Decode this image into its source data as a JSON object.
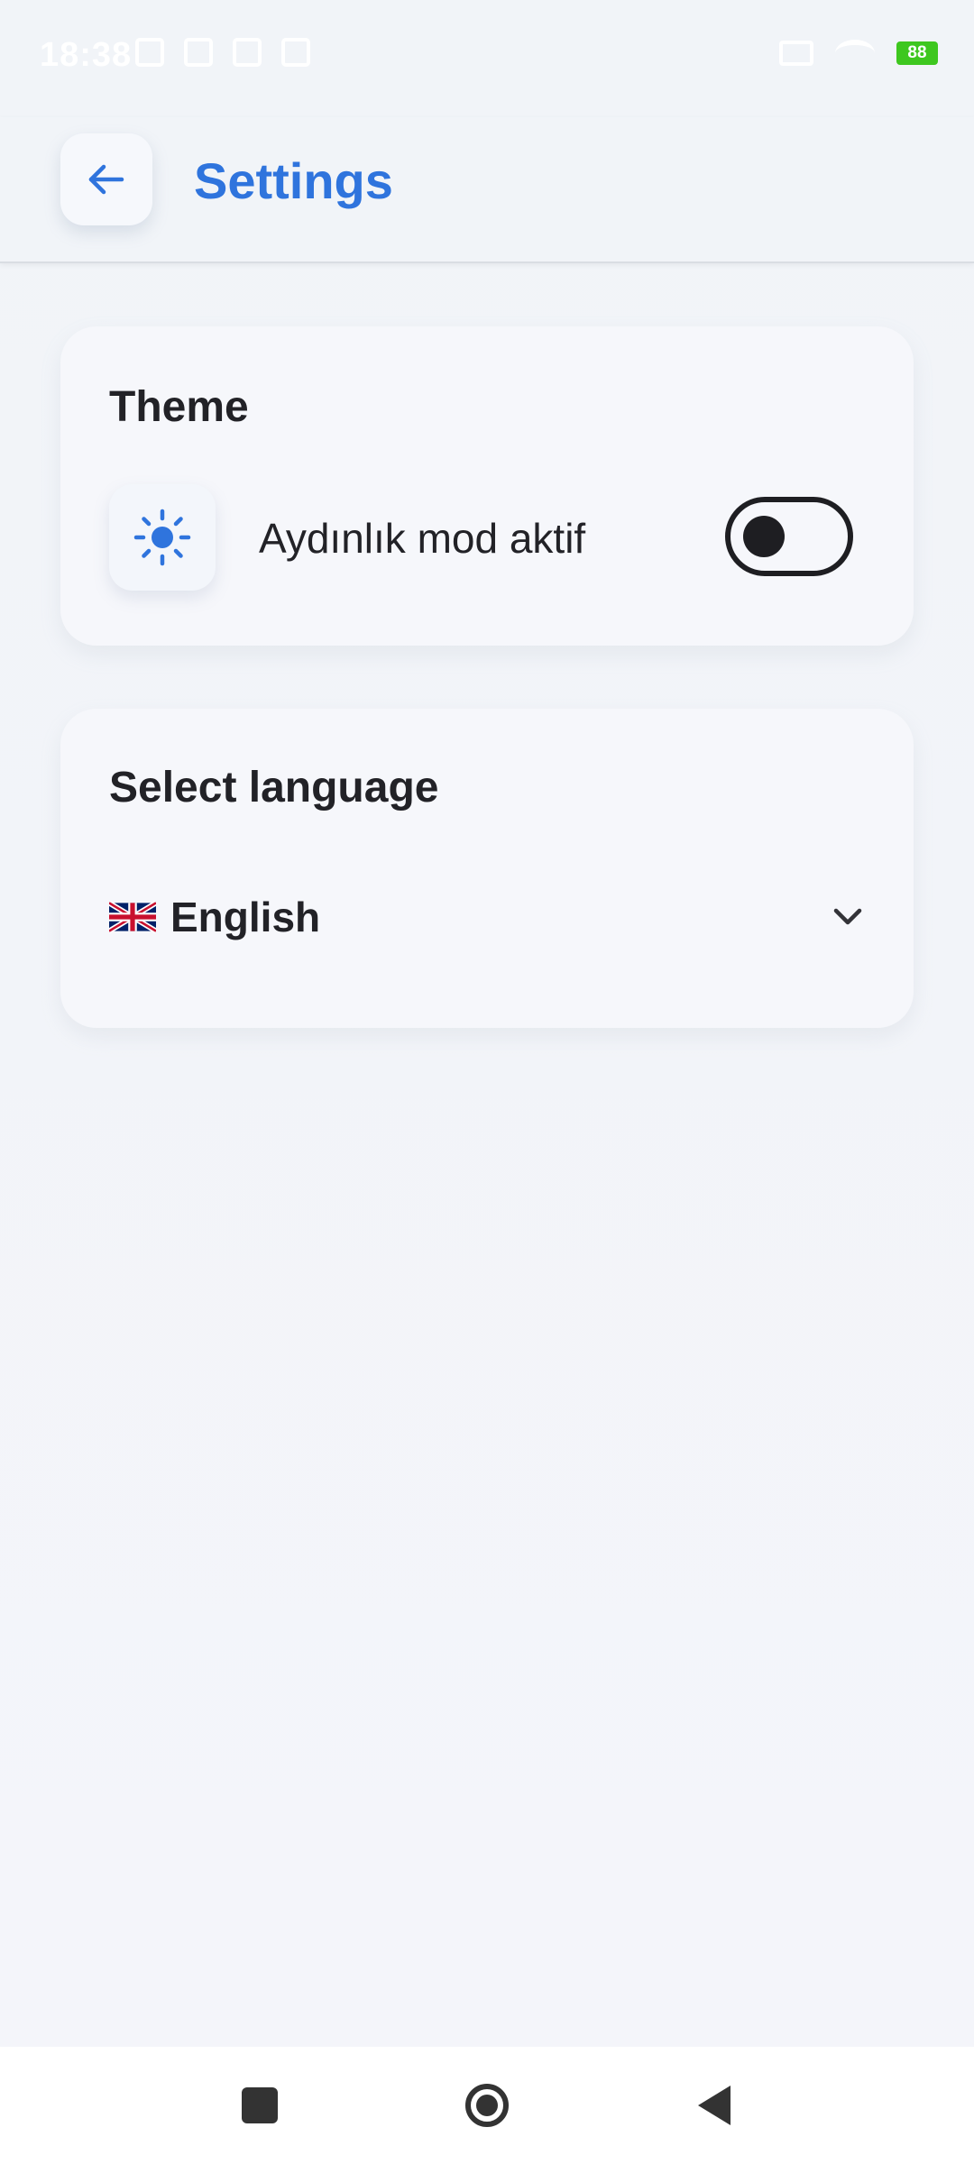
{
  "status_bar": {
    "time": "18:38",
    "battery": "88",
    "icons": [
      "notification-icon",
      "sim-icon",
      "calendar-icon",
      "calendar-icon",
      "network-icon",
      "wifi-icon",
      "battery-icon"
    ]
  },
  "header": {
    "title": "Settings",
    "back_icon": "arrow-left-icon"
  },
  "theme_card": {
    "title": "Theme",
    "mode_label": "Aydınlık mod aktif",
    "icon": "sun-icon",
    "toggle_on": false
  },
  "language_card": {
    "title": "Select language",
    "selected_language": "English",
    "flag_icon": "uk-flag-icon",
    "dropdown_icon": "chevron-down-icon"
  },
  "nav_bar": {
    "buttons": [
      "recent-apps-icon",
      "home-icon",
      "back-icon"
    ]
  },
  "colors": {
    "accent": "#2f74dd",
    "text": "#222227",
    "background": "#f1f4f8",
    "battery_green": "#3ec71f"
  }
}
